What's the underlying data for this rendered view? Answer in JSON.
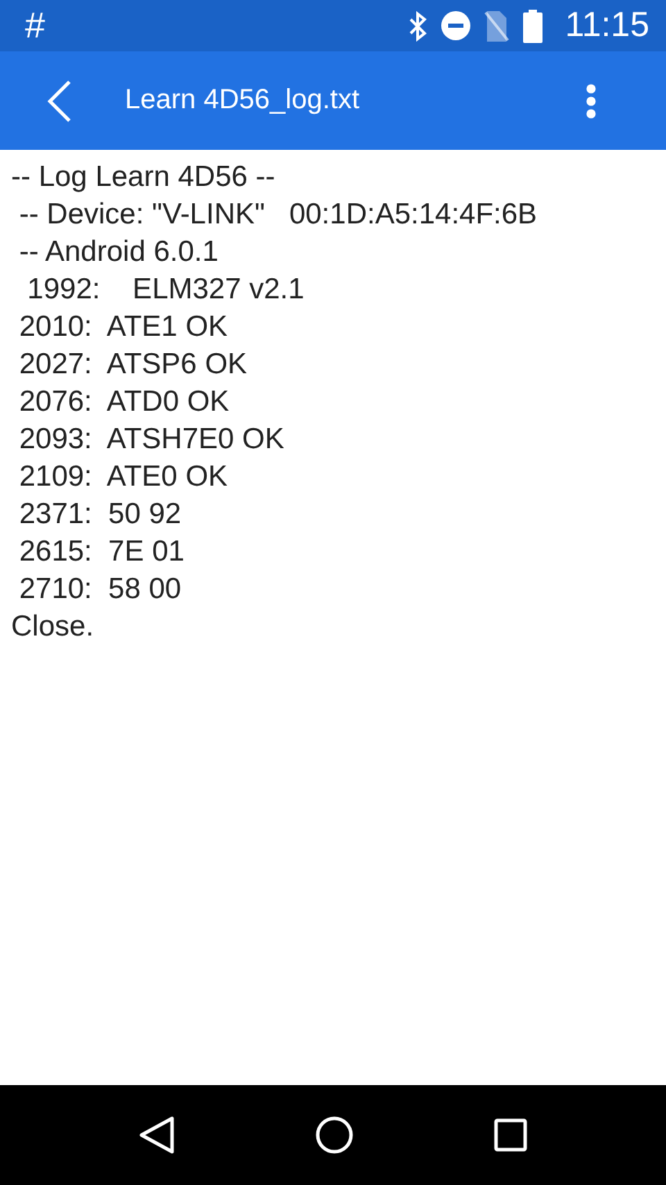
{
  "status_bar": {
    "notification": "#",
    "time": "11:15"
  },
  "app_bar": {
    "title": "Learn 4D56_log.txt"
  },
  "log_lines": [
    "-- Log Learn 4D56 --",
    " -- Device: \"V-LINK\"   00:1D:A5:14:4F:6B",
    " -- Android 6.0.1",
    "  1992:    ELM327 v2.1",
    " 2010:  ATE1 OK",
    " 2027:  ATSP6 OK",
    " 2076:  ATD0 OK",
    " 2093:  ATSH7E0 OK",
    " 2109:  ATE0 OK",
    " 2371:  50 92",
    " 2615:  7E 01",
    " 2710:  58 00",
    "Close."
  ]
}
